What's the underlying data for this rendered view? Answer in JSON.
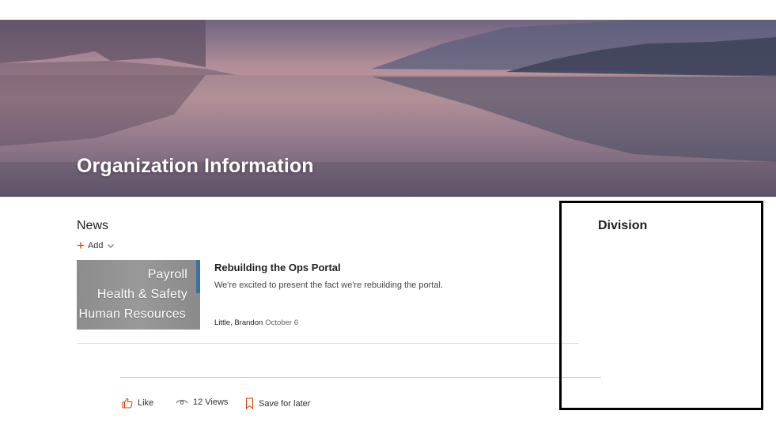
{
  "header": {
    "title": "Organization Information"
  },
  "news": {
    "section_title": "News",
    "add_label": "Add",
    "items": [
      {
        "thumbnail_lines": [
          "Payroll",
          "Health & Safety",
          "Human Resources"
        ],
        "headline": "Rebuilding the Ops Portal",
        "description": "We're excited to present the fact we're rebuilding the portal.",
        "author": "Little, Brandon",
        "date": "October 6"
      }
    ]
  },
  "footer": {
    "like_label": "Like",
    "views_label": "12 Views",
    "save_label": "Save for later"
  },
  "division": {
    "title": "Division"
  },
  "colors": {
    "accent": "#d83b01",
    "text": "#323130",
    "highlight_border": "#000000"
  },
  "icons": {
    "add": "plus-icon",
    "add_menu": "chevron-down-icon",
    "like": "like-icon",
    "views": "eye-icon",
    "save": "bookmark-icon"
  }
}
